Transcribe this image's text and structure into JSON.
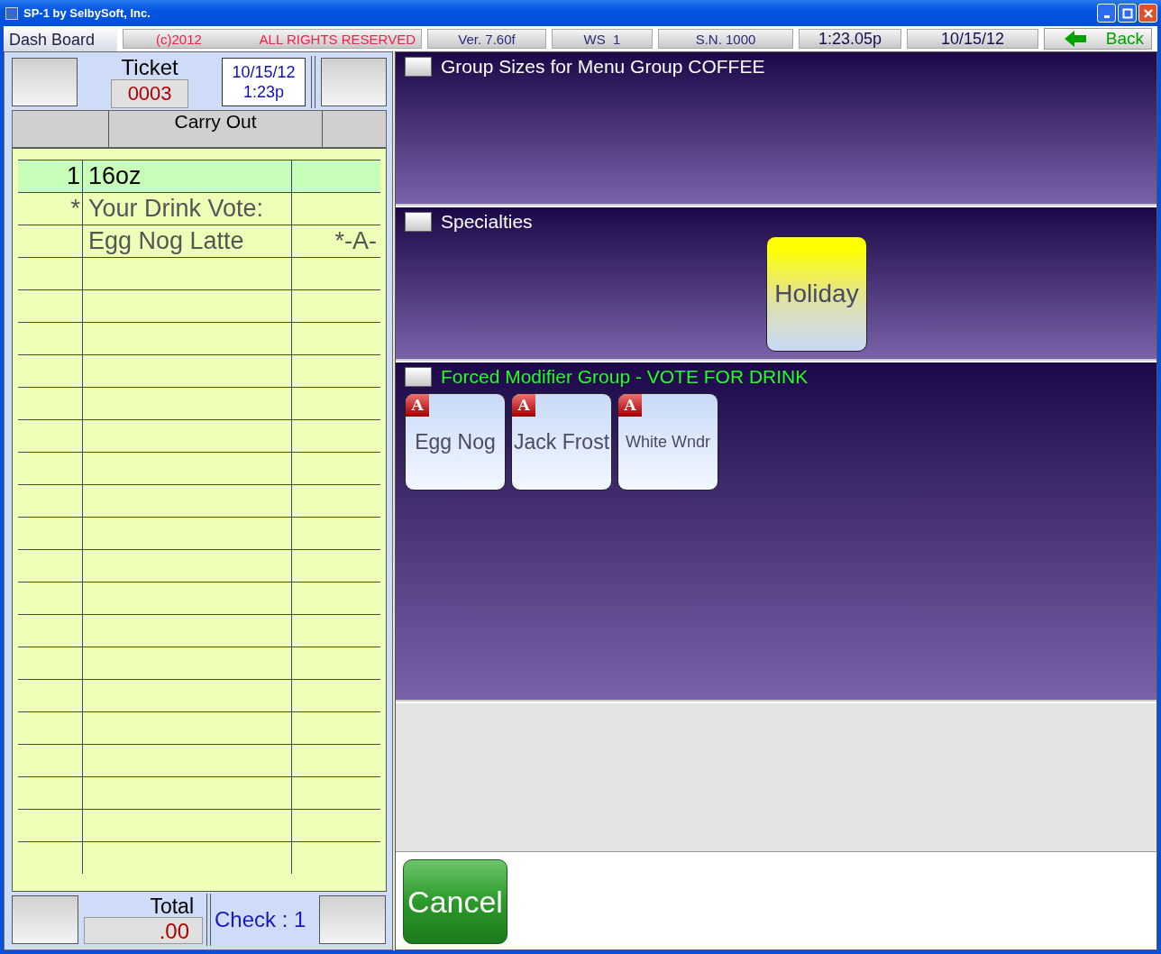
{
  "window": {
    "title": "SP-1 by SelbySoft, Inc."
  },
  "status_bar": {
    "tab": "Dash Board",
    "copyright": "(c)2012",
    "rights": "ALL RIGHTS RESERVED",
    "version": "Ver. 7.60f",
    "workstation": "WS  1",
    "serial": "S.N. 1000",
    "time": "1:23.05p",
    "date": "10/15/12",
    "back": "Back"
  },
  "ticket": {
    "label": "Ticket",
    "number": "0003",
    "date": "10/15/12",
    "time": "1:23p",
    "order_type": "Carry Out",
    "lines": [
      {
        "qty": "1",
        "item": "16oz",
        "selected": true
      },
      {
        "qty": "*",
        "item": "Your Drink Vote:",
        "selected": false
      },
      {
        "item": "Egg Nog Latte",
        "flag": "*-A-",
        "selected": false
      }
    ]
  },
  "footer": {
    "total_label": "Total",
    "total": ".00",
    "check": "Check : 1"
  },
  "groups": [
    {
      "kind": "sizes",
      "title": "Group Sizes for Menu Group COFFEE"
    },
    {
      "kind": "specialties",
      "title": "Specialties",
      "buttons": [
        {
          "kind": "plain",
          "label": "Holiday"
        }
      ]
    },
    {
      "kind": "forced",
      "title": "Forced Modifier Group - VOTE FOR DRINK",
      "buttons": [
        {
          "kind": "tagged",
          "badge": "A",
          "label": "Egg Nog"
        },
        {
          "kind": "tagged",
          "badge": "A",
          "label": "Jack Frost"
        },
        {
          "kind": "tagged",
          "badge": "A",
          "label": "White Wndr"
        }
      ]
    }
  ],
  "cancel": "Cancel"
}
